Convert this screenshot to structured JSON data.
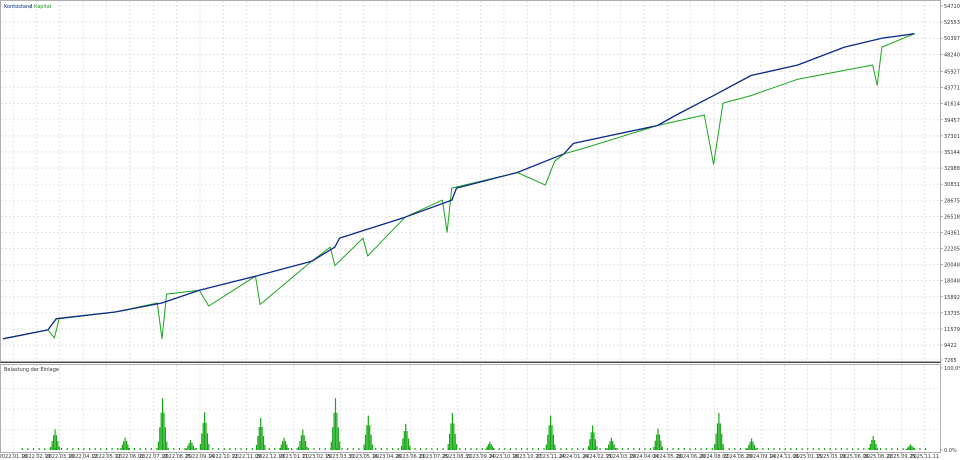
{
  "chart_data": [
    {
      "type": "line",
      "legend": {
        "balance_label": "Kontostand",
        "separator": "/",
        "equity_label": "Kapital",
        "placement": "top-left"
      },
      "colors": {
        "balance": "#0b2a8a",
        "equity": "#1aa51a",
        "grid": "#d4d4d4",
        "axis": "#b0b0b0",
        "separator": "#555555"
      },
      "grid": true,
      "x_dates": [
        "2022.01.10",
        "2022.02.10",
        "2022.03.10",
        "2022.04.12",
        "2022.05.12",
        "2022.06.02",
        "2022.07.10",
        "2022.08.25",
        "2022.09.14",
        "2022.10.12",
        "2022.11.09",
        "2022.12.10",
        "2023.01.11",
        "2023.02.15",
        "2023.03.31",
        "2023.05.16",
        "2023.04.26",
        "2023.06.23",
        "2023.07.25",
        "2023.08.31",
        "2023.09.24",
        "2023.10.18",
        "2023.10.27",
        "2023.11.24",
        "2024.01.24",
        "2024.02.15",
        "2024.03.19",
        "2024.04.04",
        "2024.05.28",
        "2024.06.20",
        "2024.08.02",
        "2024.08.29",
        "2024.09.14",
        "2024.11.06",
        "2025.01.15",
        "2025.03.19",
        "2025.06.06",
        "2025.08.22",
        "2025.09.25",
        "2025.11.11",
        "2026.02.06"
      ],
      "ylim": [
        7265,
        54710
      ],
      "yticks": [
        54710,
        52553,
        50397,
        48240,
        45927,
        43771,
        41614,
        39457,
        37301,
        35144,
        32988,
        30831,
        28675,
        26518,
        24361,
        22205,
        20048,
        17892,
        15735,
        13579,
        11422,
        9265,
        7265
      ],
      "ytick_labels": [
        "54710",
        "52553",
        "50397",
        "48240",
        "45927",
        "43771",
        "41614",
        "39457",
        "37301",
        "35144",
        "32988",
        "30831",
        "28675",
        "26518",
        "24361",
        "22205",
        "20048",
        "18048",
        "15892",
        "13735",
        "11579",
        "9422",
        "7265"
      ],
      "series": [
        {
          "name": "Kontostand",
          "x": [
            0,
            0.048,
            0.057,
            0.12,
            0.17,
            0.21,
            0.27,
            0.33,
            0.355,
            0.36,
            0.43,
            0.48,
            0.485,
            0.55,
            0.6,
            0.61,
            0.7,
            0.72,
            0.76,
            0.8,
            0.85,
            0.9,
            0.94,
            0.975
          ],
          "y": [
            10100,
            11300,
            12800,
            13700,
            14900,
            16600,
            18500,
            20500,
            22400,
            23600,
            26400,
            28700,
            30300,
            32400,
            34900,
            36300,
            38700,
            40100,
            42700,
            45400,
            46800,
            49200,
            50400,
            51000
          ]
        },
        {
          "name": "Kapital",
          "x": [
            0,
            0.048,
            0.055,
            0.06,
            0.12,
            0.165,
            0.17,
            0.175,
            0.21,
            0.22,
            0.27,
            0.275,
            0.33,
            0.35,
            0.355,
            0.385,
            0.39,
            0.43,
            0.47,
            0.475,
            0.48,
            0.55,
            0.58,
            0.59,
            0.6,
            0.62,
            0.7,
            0.75,
            0.76,
            0.77,
            0.8,
            0.85,
            0.93,
            0.935,
            0.94,
            0.975
          ],
          "y": [
            10100,
            11300,
            10200,
            12800,
            13700,
            14900,
            10100,
            16100,
            16600,
            14500,
            18500,
            14700,
            20500,
            22400,
            19900,
            23600,
            21200,
            26400,
            28700,
            24400,
            30300,
            32400,
            30700,
            33900,
            34900,
            35600,
            38700,
            40100,
            33500,
            41700,
            42700,
            44900,
            46800,
            44100,
            49200,
            51000
          ]
        }
      ]
    },
    {
      "type": "bar",
      "title": "Belastung der Einlage",
      "ylim": [
        0,
        100
      ],
      "yticks": [
        100,
        0
      ],
      "ytick_labels": [
        "100.0%",
        "0.0%"
      ],
      "colors": {
        "bar": "#15a815"
      },
      "peaks": [
        {
          "x": 0.055,
          "height": 25
        },
        {
          "x": 0.13,
          "height": 15
        },
        {
          "x": 0.17,
          "height": 63
        },
        {
          "x": 0.2,
          "height": 12
        },
        {
          "x": 0.215,
          "height": 46
        },
        {
          "x": 0.275,
          "height": 39
        },
        {
          "x": 0.3,
          "height": 15
        },
        {
          "x": 0.32,
          "height": 25
        },
        {
          "x": 0.355,
          "height": 63
        },
        {
          "x": 0.39,
          "height": 42
        },
        {
          "x": 0.43,
          "height": 32
        },
        {
          "x": 0.48,
          "height": 45
        },
        {
          "x": 0.52,
          "height": 10
        },
        {
          "x": 0.585,
          "height": 42
        },
        {
          "x": 0.63,
          "height": 30
        },
        {
          "x": 0.65,
          "height": 15
        },
        {
          "x": 0.7,
          "height": 26
        },
        {
          "x": 0.765,
          "height": 45
        },
        {
          "x": 0.8,
          "height": 14
        },
        {
          "x": 0.93,
          "height": 17
        },
        {
          "x": 0.97,
          "height": 7
        }
      ]
    }
  ]
}
